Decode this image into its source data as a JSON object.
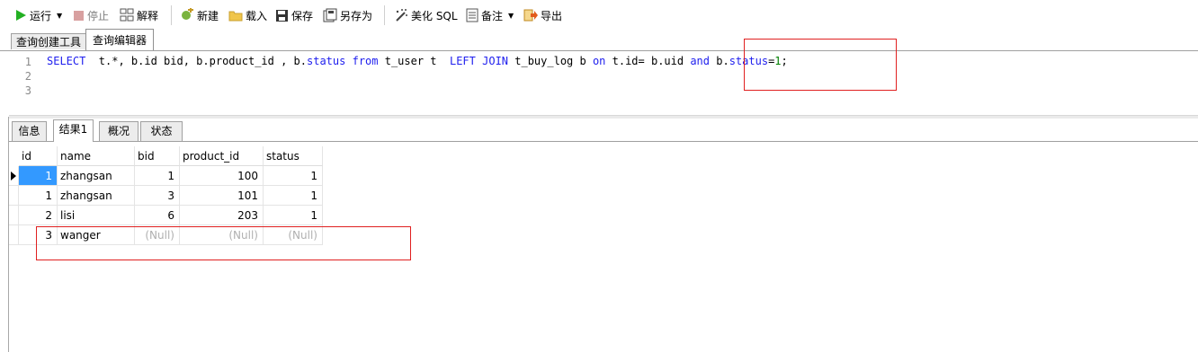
{
  "toolbar": {
    "run": "运行",
    "stop": "停止",
    "explain": "解释",
    "new": "新建",
    "load": "载入",
    "save": "保存",
    "save_as": "另存为",
    "beautify": "美化 SQL",
    "comment": "备注",
    "export": "导出"
  },
  "editor_tabs": [
    "查询创建工具",
    "查询编辑器"
  ],
  "code": {
    "line_numbers": [
      "1",
      "2",
      "3"
    ],
    "tokens": [
      {
        "t": "SELECT",
        "k": "kw"
      },
      {
        "t": "  t.*, b.id bid, b.product_id , b.",
        "k": ""
      },
      {
        "t": "status",
        "k": "kw"
      },
      {
        "t": " ",
        "k": ""
      },
      {
        "t": "from",
        "k": "kw"
      },
      {
        "t": " t_user t  ",
        "k": ""
      },
      {
        "t": "LEFT",
        "k": "kw"
      },
      {
        "t": " ",
        "k": ""
      },
      {
        "t": "JOIN",
        "k": "kw"
      },
      {
        "t": " t_buy_log b ",
        "k": ""
      },
      {
        "t": "on",
        "k": "kw"
      },
      {
        "t": " t.id= b.uid ",
        "k": ""
      },
      {
        "t": "and",
        "k": "kw"
      },
      {
        "t": " b.",
        "k": ""
      },
      {
        "t": "status",
        "k": "kw"
      },
      {
        "t": "=",
        "k": ""
      },
      {
        "t": "1",
        "k": "num"
      },
      {
        "t": ";",
        "k": ""
      }
    ]
  },
  "result_tabs": [
    "信息",
    "结果1",
    "概况",
    "状态"
  ],
  "table": {
    "columns": [
      "id",
      "name",
      "bid",
      "product_id",
      "status"
    ],
    "rows": [
      [
        "1",
        "zhangsan",
        "1",
        "100",
        "1"
      ],
      [
        "1",
        "zhangsan",
        "3",
        "101",
        "1"
      ],
      [
        "2",
        "lisi",
        "6",
        "203",
        "1"
      ],
      [
        "3",
        "wanger",
        "(Null)",
        "(Null)",
        "(Null)"
      ]
    ]
  },
  "colors": {
    "keyword": "#2020ee",
    "number": "#008000",
    "annotation_box": "#e02020",
    "selection": "#3399ff"
  }
}
